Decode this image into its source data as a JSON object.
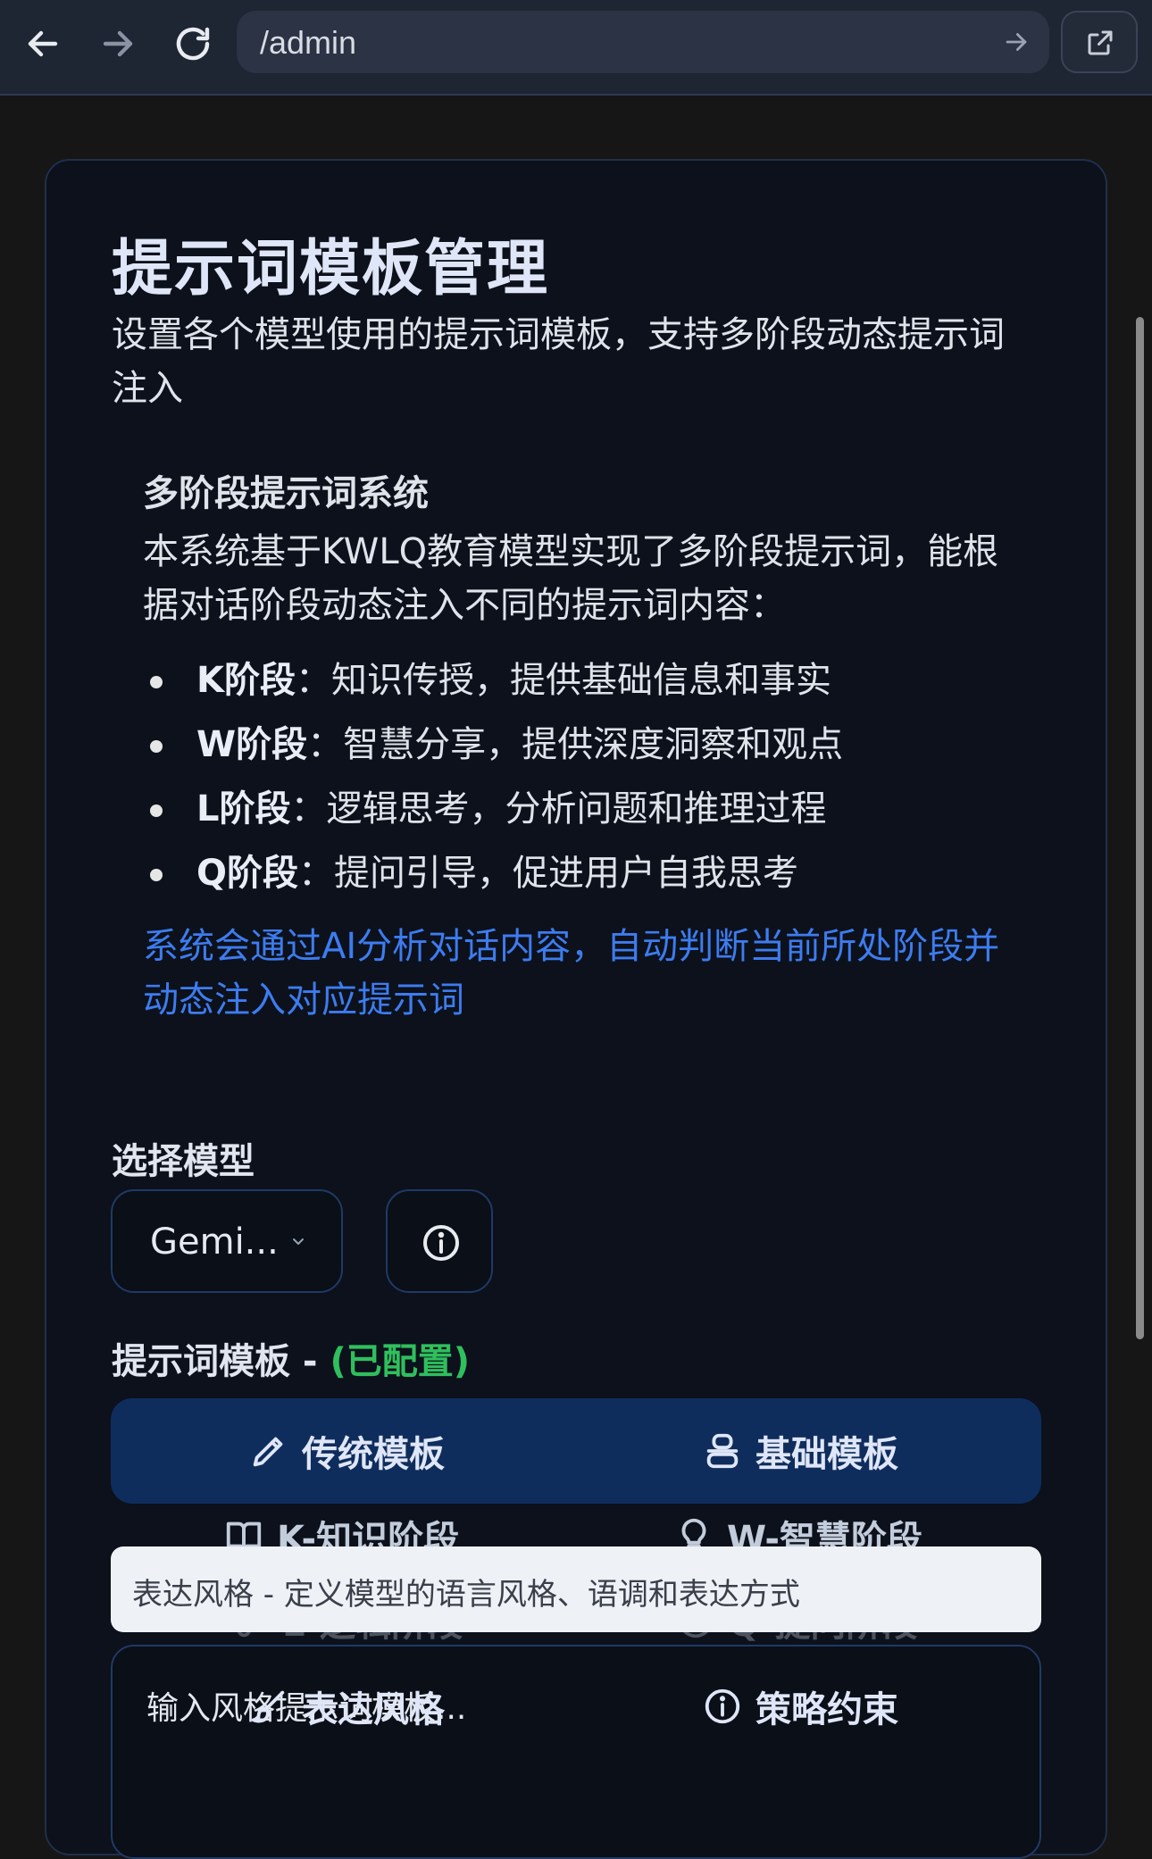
{
  "browser": {
    "url": "/admin"
  },
  "page": {
    "title": "提示词模板管理",
    "subtitle": "设置各个模型使用的提示词模板，支持多阶段动态提示词注入"
  },
  "info": {
    "title": "多阶段提示词系统",
    "description": "本系统基于KWLQ教育模型实现了多阶段提示词，能根据对话阶段动态注入不同的提示词内容：",
    "stages": [
      {
        "name": "K阶段",
        "sep": "：",
        "text": "知识传授，提供基础信息和事实"
      },
      {
        "name": "W阶段",
        "sep": "：",
        "text": "智慧分享，提供深度洞察和观点"
      },
      {
        "name": "L阶段",
        "sep": "：",
        "text": "逻辑思考，分析问题和推理过程"
      },
      {
        "name": "Q阶段",
        "sep": "：",
        "text": "提问引导，促进用户自我思考"
      }
    ],
    "note": "系统会通过AI分析对话内容，自动判断当前所处阶段并动态注入对应提示词"
  },
  "model": {
    "label": "选择模型",
    "selected": "Gemi..."
  },
  "template": {
    "label": "提示词模板 - ",
    "status": "(已配置)",
    "tabs": {
      "traditional": "传统模板",
      "basic": "基础模板",
      "k_stage": "K-知识阶段",
      "w_stage": "W-智慧阶段",
      "l_stage": "L-逻辑阶段",
      "q_stage": "Q-提问阶段",
      "style": "表达风格",
      "constraints": "策略约束"
    },
    "tooltip": "表达风格 - 定义模型的语言风格、语调和表达方式",
    "placeholder": "输入风格提示词模板..."
  },
  "colors": {
    "accent": "#3d7cf0",
    "status_ok": "#2fbf5d",
    "tab_panel": "#0f2d5c"
  }
}
